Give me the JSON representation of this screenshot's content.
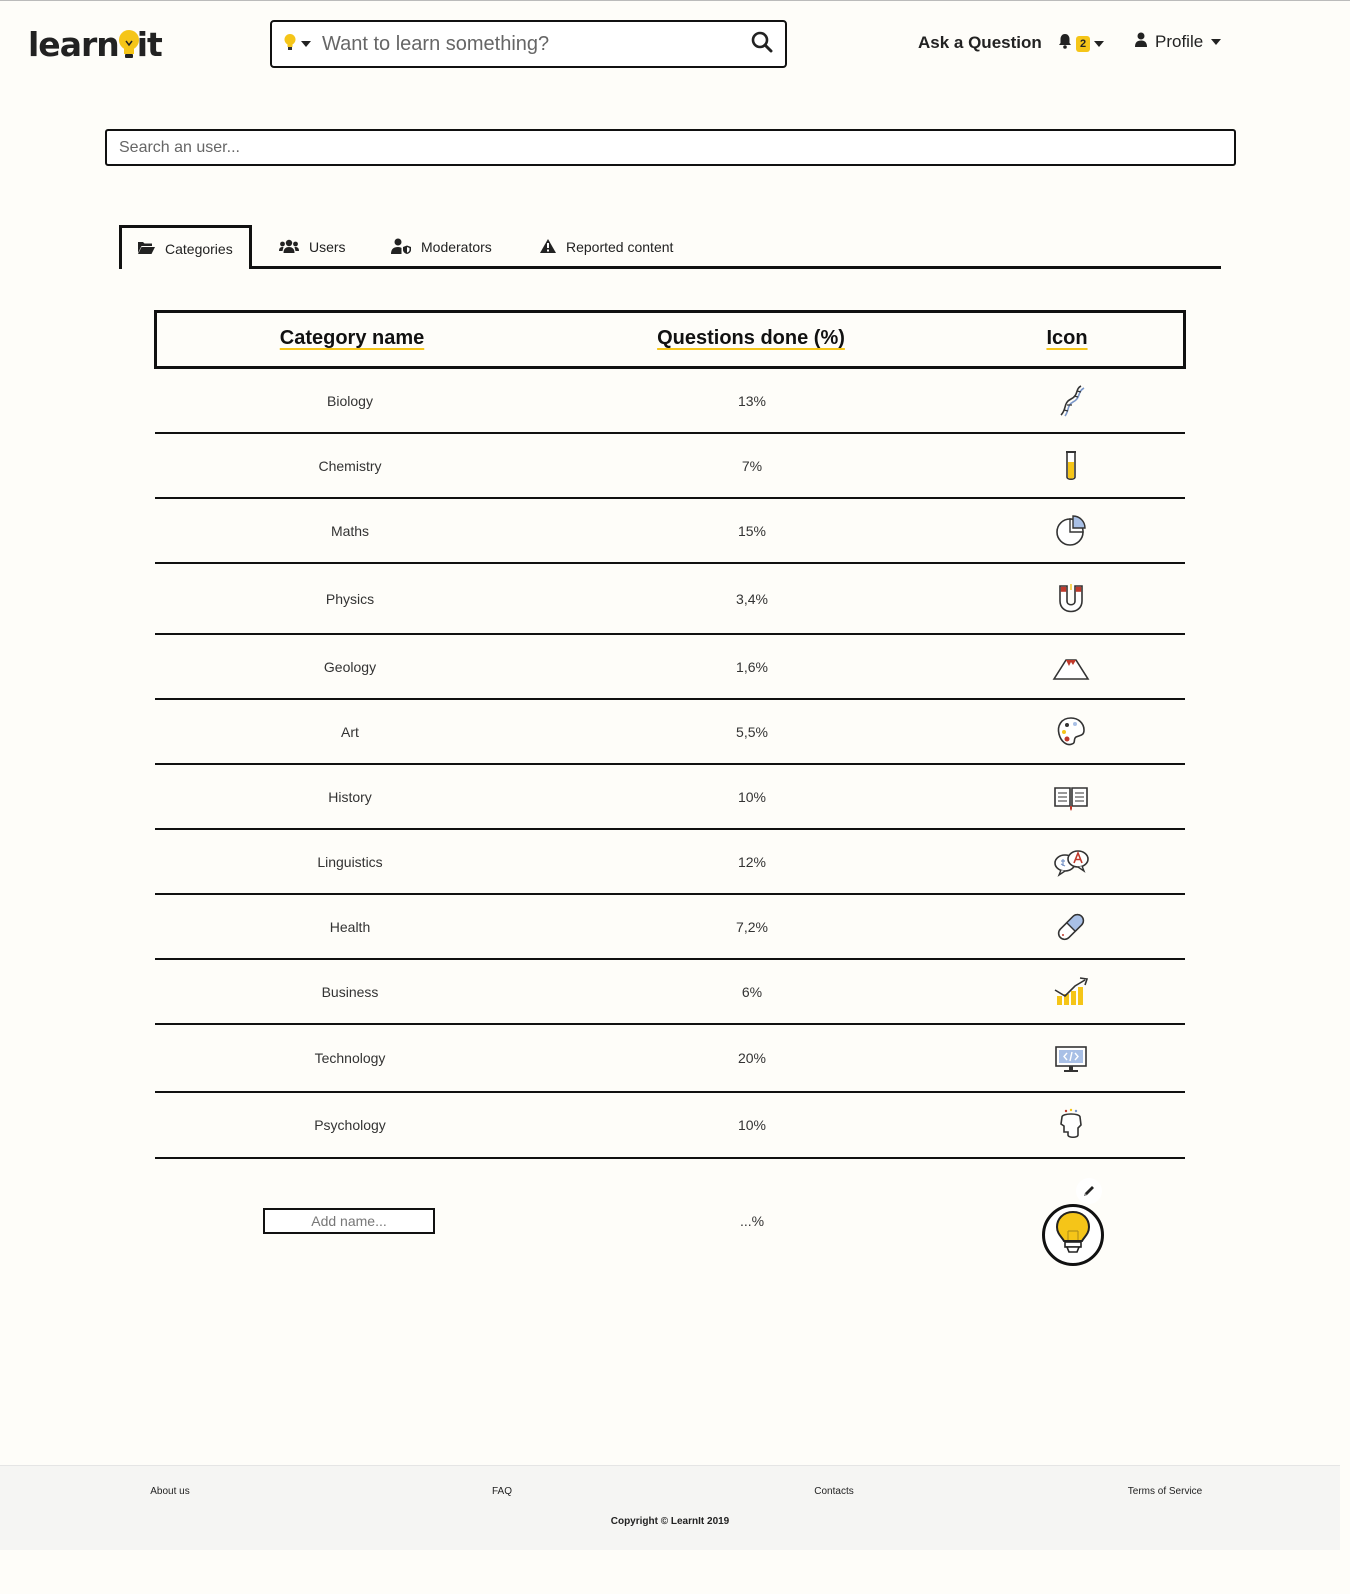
{
  "brand": {
    "name_part1": "learn",
    "name_part2": "it",
    "accent": "#f5c518"
  },
  "search": {
    "placeholder": "Want to learn something?",
    "category_icon": "lightbulb-icon",
    "button_icon": "search-icon"
  },
  "nav": {
    "ask_label": "Ask a Question",
    "notifications_count": "2",
    "profile_label": "Profile"
  },
  "user_search": {
    "placeholder": "Search an user..."
  },
  "tabs": [
    {
      "label": "Categories",
      "icon": "folder-open-icon",
      "active": true
    },
    {
      "label": "Users",
      "icon": "users-icon",
      "active": false
    },
    {
      "label": "Moderators",
      "icon": "user-shield-icon",
      "active": false
    },
    {
      "label": "Reported content",
      "icon": "warning-icon",
      "active": false
    }
  ],
  "table": {
    "headers": {
      "name": "Category name",
      "questions": "Questions done (%)",
      "icon": "Icon"
    },
    "rows": [
      {
        "name": "Biology",
        "questions": "13%",
        "icon": "dna-icon"
      },
      {
        "name": "Chemistry",
        "questions": "7%",
        "icon": "test-tube-icon"
      },
      {
        "name": "Maths",
        "questions": "15%",
        "icon": "pie-chart-icon"
      },
      {
        "name": "Physics",
        "questions": "3,4%",
        "icon": "magnet-icon"
      },
      {
        "name": "Geology",
        "questions": "1,6%",
        "icon": "volcano-icon"
      },
      {
        "name": "Art",
        "questions": "5,5%",
        "icon": "palette-icon"
      },
      {
        "name": "History",
        "questions": "10%",
        "icon": "open-book-icon"
      },
      {
        "name": "Linguistics",
        "questions": "12%",
        "icon": "speech-bubbles-icon"
      },
      {
        "name": "Health",
        "questions": "7,2%",
        "icon": "pill-icon"
      },
      {
        "name": "Business",
        "questions": "6%",
        "icon": "growth-chart-icon"
      },
      {
        "name": "Technology",
        "questions": "20%",
        "icon": "code-monitor-icon"
      },
      {
        "name": "Psychology",
        "questions": "10%",
        "icon": "brain-head-icon"
      }
    ],
    "new_row": {
      "name_placeholder": "Add name...",
      "questions": "...%",
      "icon": "lightbulb-icon",
      "edit_icon": "pencil-icon"
    }
  },
  "footer": {
    "links": [
      "About us",
      "FAQ",
      "Contacts",
      "Terms of Service"
    ],
    "copyright": "Copyright © LearnIt 2019"
  }
}
